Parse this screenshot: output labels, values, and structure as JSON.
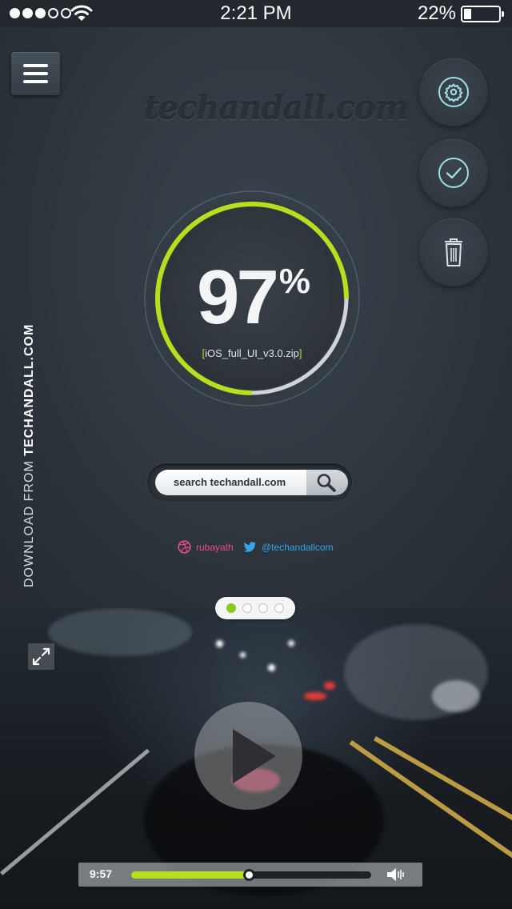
{
  "status_bar": {
    "signal_strength": 3,
    "signal_total": 5,
    "time": "2:21 PM",
    "battery_percent": "22%",
    "battery_level": 0.22
  },
  "header": {
    "menu_icon": "hamburger-icon",
    "logo_text": "techandall.com"
  },
  "actions": [
    {
      "name": "settings",
      "icon": "gear-icon"
    },
    {
      "name": "confirm",
      "icon": "check-icon"
    },
    {
      "name": "delete",
      "icon": "trash-icon"
    }
  ],
  "progress": {
    "percent_value": "97",
    "percent_sign": "%",
    "fraction": 0.75,
    "file_label_open": "[",
    "file_name": "iOS_full_UI_v3.0.zip",
    "file_label_close": "]",
    "accent_color": "#b6e01e",
    "remaining_color": "#d0d4d8"
  },
  "search": {
    "placeholder": "search techandall.com",
    "button_icon": "search-icon"
  },
  "social": {
    "dribbble_handle": "rubayath",
    "twitter_handle": "@techandallcom",
    "dribbble_color": "#ea4c89",
    "twitter_color": "#37a3ea"
  },
  "side_banner": {
    "prefix": "DOWNLOAD FROM ",
    "site": "TECHANDALL.COM"
  },
  "pager": {
    "count": 4,
    "active_index": 0
  },
  "video": {
    "expand_icon": "expand-icon",
    "play_icon": "play-icon",
    "time": "9:57",
    "progress": 0.49,
    "volume_icon": "volume-icon"
  }
}
